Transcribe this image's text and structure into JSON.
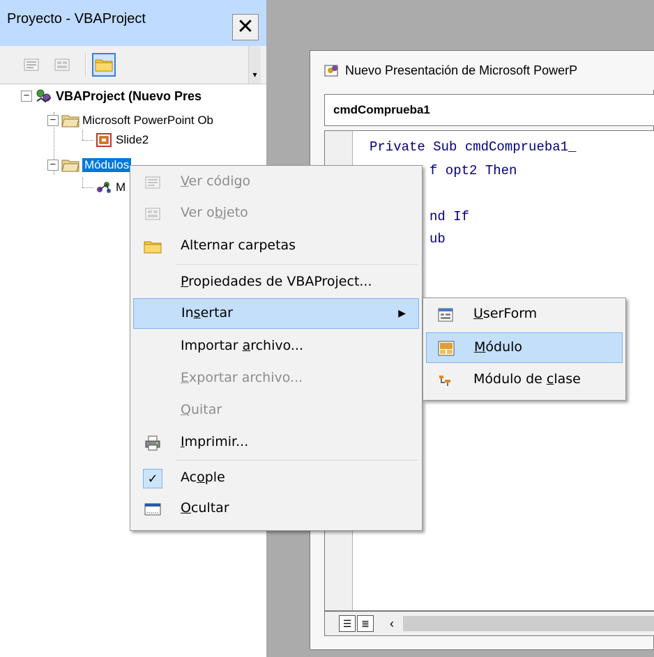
{
  "project_pane": {
    "title": "Proyecto - VBAProject",
    "close_label": "✕",
    "toolbar": {
      "buttons": [
        "view-code",
        "view-object",
        "toggle-folders"
      ]
    },
    "tree": {
      "root": "VBAProject (Nuevo Pres",
      "ppt_objects": "Microsoft PowerPoint Ob",
      "slide": "Slide2",
      "modules_folder": "Módulos",
      "module_partial": "M"
    }
  },
  "code_window": {
    "title": "Nuevo Presentación de Microsoft PowerP",
    "object_combo": "cmdComprueba1",
    "lines": [
      "Private Sub cmdComprueba1_",
      "If opt2 Then",
      "End If",
      "Sub"
    ],
    "lines_visible": [
      "Private Sub cmdComprueba1_",
      "f opt2 Then",
      "nd If",
      "ub"
    ]
  },
  "context_menu": {
    "items": [
      {
        "pre": "",
        "u": "V",
        "post": "er código",
        "disabled": true
      },
      {
        "pre": "Ver o",
        "u": "b",
        "post": "jeto",
        "disabled": true
      },
      {
        "pre": "Alternar carpetas",
        "u": "",
        "post": "",
        "disabled": false
      },
      {
        "pre": "",
        "u": "P",
        "post": "ropiedades de VBAProject...",
        "disabled": false
      },
      {
        "pre": "In",
        "u": "s",
        "post": "ertar",
        "disabled": false
      },
      {
        "pre": "Importar ",
        "u": "a",
        "post": "rchivo...",
        "disabled": false
      },
      {
        "pre": "",
        "u": "E",
        "post": "xportar archivo...",
        "disabled": true
      },
      {
        "pre": "",
        "u": "Q",
        "post": "uitar",
        "disabled": true
      },
      {
        "pre": "",
        "u": "I",
        "post": "mprimir...",
        "disabled": false
      },
      {
        "pre": "Ac",
        "u": "o",
        "post": "ple",
        "disabled": false
      },
      {
        "pre": "",
        "u": "O",
        "post": "cultar",
        "disabled": false
      }
    ]
  },
  "submenu": {
    "items": [
      {
        "pre": "",
        "u": "U",
        "post": "serForm"
      },
      {
        "pre": "",
        "u": "M",
        "post": "ódulo"
      },
      {
        "pre": "Módulo de ",
        "u": "c",
        "post": "lase"
      }
    ]
  },
  "colors": {
    "titlebar": "#bfdbff",
    "selection": "#0078d7",
    "menu_highlight": "#c4dffa",
    "code_keyword": "#000080"
  }
}
